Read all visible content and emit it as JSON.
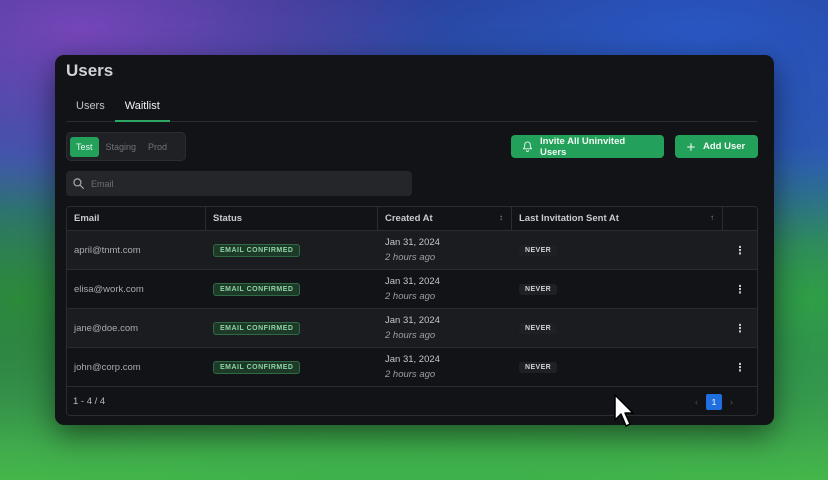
{
  "page": {
    "title": "Users"
  },
  "tabs": [
    {
      "label": "Users",
      "active": false
    },
    {
      "label": "Waitlist",
      "active": true
    }
  ],
  "environment": {
    "options": [
      "Test",
      "Staging",
      "Prod"
    ],
    "selected": "Test"
  },
  "actions": {
    "invite_label": "Invite All Uninvited Users",
    "invite_icon": "bell-icon",
    "add_label": "Add User",
    "add_icon": "plus-icon"
  },
  "search": {
    "placeholder": "Email",
    "value": ""
  },
  "table": {
    "columns": {
      "email": "Email",
      "status": "Status",
      "created": "Created At",
      "last_invite": "Last Invitation Sent At"
    },
    "rows": [
      {
        "email": "april@tnmt.com",
        "status": "EMAIL CONFIRMED",
        "created_date": "Jan 31, 2024",
        "created_rel": "2 hours ago",
        "last_invite": "NEVER"
      },
      {
        "email": "elisa@work.com",
        "status": "EMAIL CONFIRMED",
        "created_date": "Jan 31, 2024",
        "created_rel": "2 hours ago",
        "last_invite": "NEVER"
      },
      {
        "email": "jane@doe.com",
        "status": "EMAIL CONFIRMED",
        "created_date": "Jan 31, 2024",
        "created_rel": "2 hours ago",
        "last_invite": "NEVER"
      },
      {
        "email": "john@corp.com",
        "status": "EMAIL CONFIRMED",
        "created_date": "Jan 31, 2024",
        "created_rel": "2 hours ago",
        "last_invite": "NEVER"
      }
    ],
    "kebab": "⋮"
  },
  "footer": {
    "range": "1 - 4 / 4",
    "current_page": "1",
    "prev": "‹",
    "next": "›"
  },
  "colors": {
    "accent": "#23a15a",
    "page_active": "#1f6fe0"
  }
}
